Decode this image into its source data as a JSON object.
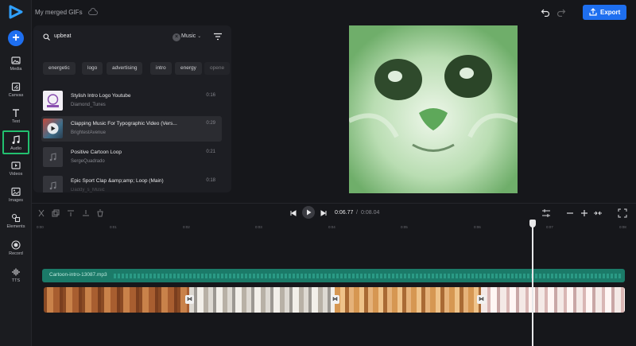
{
  "app": {
    "title": "My merged GIFs",
    "accent_color": "#1e6ff0",
    "active_color": "#22c06f"
  },
  "header": {
    "export_label": "Export"
  },
  "sidebar": {
    "items": [
      {
        "label": "Media",
        "icon": "media-icon"
      },
      {
        "label": "Canvas",
        "icon": "canvas-icon"
      },
      {
        "label": "Text",
        "icon": "text-icon"
      },
      {
        "label": "Audio",
        "icon": "music-note-icon",
        "active": true
      },
      {
        "label": "Videos",
        "icon": "video-icon"
      },
      {
        "label": "Images",
        "icon": "image-icon"
      },
      {
        "label": "Elements",
        "icon": "shapes-icon"
      },
      {
        "label": "Record",
        "icon": "record-icon"
      },
      {
        "label": "TTS",
        "icon": "waveform-icon"
      }
    ]
  },
  "audio_panel": {
    "search_value": "upbeat",
    "category": "Music",
    "tags": [
      "energetic",
      "logo",
      "advertising",
      "intro",
      "energy",
      "opene"
    ],
    "tracks": [
      {
        "title": "Stylish Intro Logo Youtube",
        "artist": "Diamond_Tunes",
        "duration": "0:16"
      },
      {
        "title": "Clapping Music For Typographic Video (Vers...",
        "artist": "BrightestAvenue",
        "duration": "0:29"
      },
      {
        "title": "Positive Cartoon Loop",
        "artist": "SergeQuadrado",
        "duration": "0:21"
      },
      {
        "title": "Epic Sport Clap &amp;amp; Loop (Main)",
        "artist": "Daddy_s_Music",
        "duration": "0:18"
      }
    ]
  },
  "timeline": {
    "current_time": "0:06.77",
    "separator": "/",
    "total_time": "0:08.04",
    "ticks": [
      "0:00",
      "0:01",
      "0:02",
      "0:03",
      "0:04",
      "0:05",
      "0:06",
      "0:07",
      "0:08"
    ],
    "audio_clip": "Cartoon-intro-13087.mp3"
  }
}
